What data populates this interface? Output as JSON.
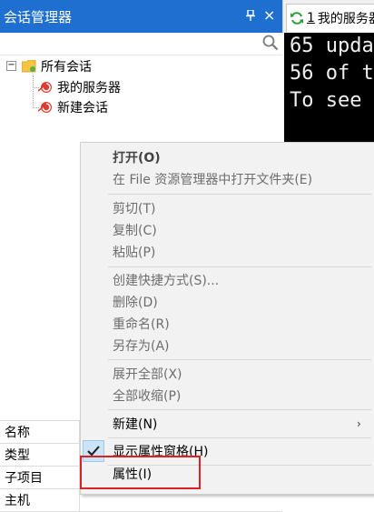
{
  "pane": {
    "title": "会话管理器",
    "pin_glyph": "¤",
    "close_glyph": "×",
    "search_placeholder": ""
  },
  "tree": {
    "expander": "−",
    "root": "所有会话",
    "children": [
      "我的服务器",
      "新建会话"
    ]
  },
  "properties": {
    "rows": [
      "名称",
      "类型",
      "子项目",
      "主机"
    ]
  },
  "tab": {
    "number": "1",
    "name": "我的服务器"
  },
  "terminal": {
    "lines": [
      "65 upda",
      "56 of t",
      "To see"
    ]
  },
  "context_menu": {
    "items": [
      {
        "label": "打开(O)",
        "enabled": true,
        "bold": true
      },
      {
        "label": "在 File 资源管理器中打开文件夹(E)",
        "enabled": false
      },
      {
        "label": "剪切(T)",
        "enabled": false
      },
      {
        "label": "复制(C)",
        "enabled": false
      },
      {
        "label": "粘贴(P)",
        "enabled": false
      },
      {
        "label": "创建快捷方式(S)...",
        "enabled": false
      },
      {
        "label": "删除(D)",
        "enabled": false
      },
      {
        "label": "重命名(R)",
        "enabled": false
      },
      {
        "label": "另存为(A)",
        "enabled": false
      },
      {
        "label": "展开全部(X)",
        "enabled": false
      },
      {
        "label": "全部收缩(P)",
        "enabled": false
      },
      {
        "label": "新建(N)",
        "enabled": true,
        "submenu": true
      },
      {
        "label": "显示属性窗格(H)",
        "enabled": true,
        "checked": true
      },
      {
        "label": "属性(I)",
        "enabled": true,
        "highlighted": true
      }
    ],
    "submenu_arrow": "›",
    "check_glyph": "✔"
  },
  "colors": {
    "title_bar": "#1e6fd0",
    "terminal_bg": "#000000",
    "menu_bg": "#f2f2f2",
    "highlight_border": "#e02020"
  }
}
